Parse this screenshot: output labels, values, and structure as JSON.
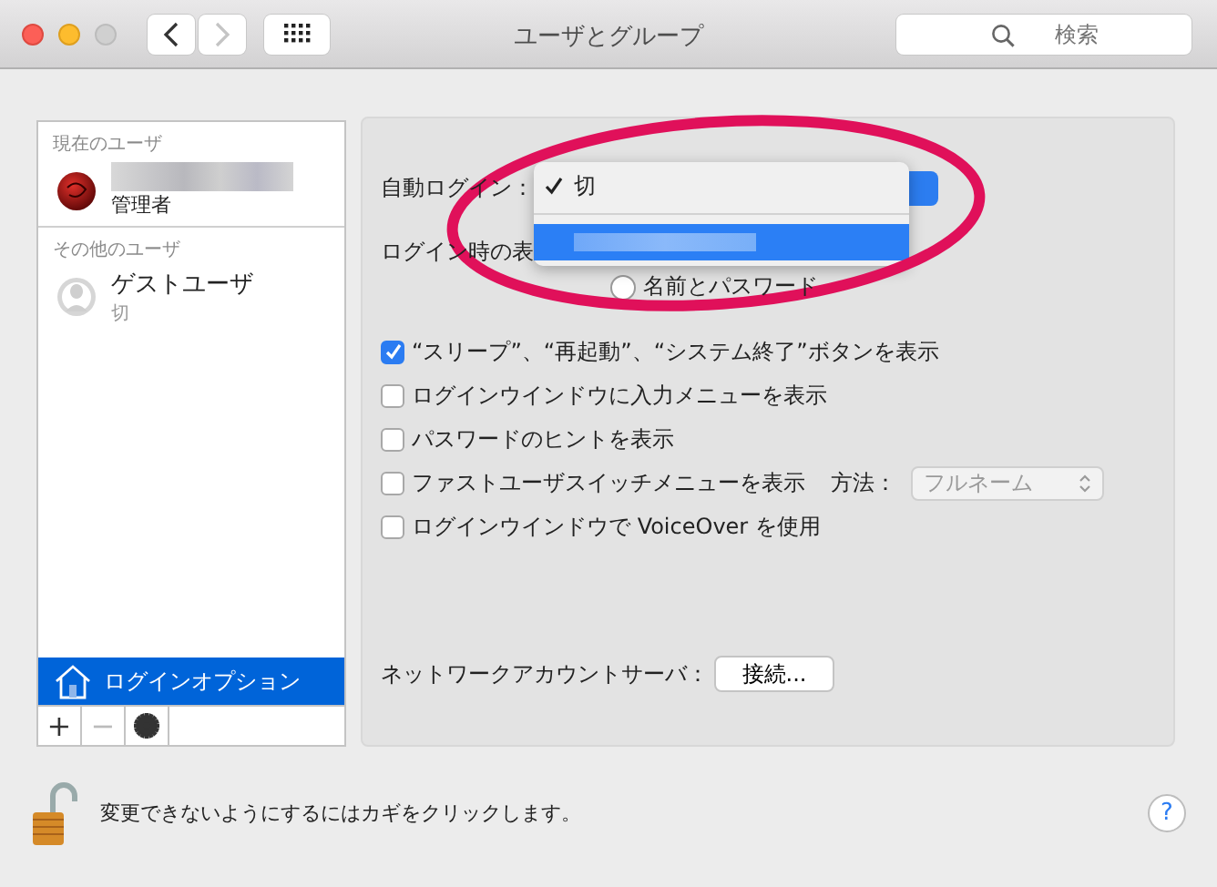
{
  "window": {
    "title": "ユーザとグループ",
    "search_placeholder": "検索",
    "nav": [
      {
        "kind": "back",
        "disabled": false
      },
      {
        "kind": "forward",
        "disabled": true
      },
      {
        "kind": "grid",
        "disabled": false
      }
    ]
  },
  "sidebar": {
    "current_heading": "現在のユーザ",
    "current_user": {
      "role": "管理者"
    },
    "other_heading": "その他のユーザ",
    "other_users": [
      {
        "name": "ゲストユーザ",
        "status": "切"
      }
    ],
    "login_options": {
      "label": "ログインオプション",
      "selected": true
    },
    "tools": [
      {
        "kind": "add",
        "label": "+",
        "disabled": false
      },
      {
        "kind": "remove",
        "label": "−",
        "disabled": true
      },
      {
        "kind": "settings",
        "disabled": false
      }
    ]
  },
  "panel": {
    "auto_login_label": "自動ログイン：",
    "menu": [
      {
        "kind": "text",
        "label": "切",
        "checked": true,
        "selected": false
      },
      {
        "kind": "blurred",
        "checked": false,
        "selected": true
      }
    ],
    "display_label": "ログイン時の表",
    "radio": {
      "label": "名前とパスワード",
      "selected": false
    },
    "checkboxes": [
      {
        "label": "“スリープ”、“再起動”、“システム終了”ボタンを表示",
        "checked": true
      },
      {
        "label": "ログインウインドウに入力メニューを表示",
        "checked": false
      },
      {
        "label": "パスワードのヒントを表示",
        "checked": false
      },
      {
        "label": "ファストユーザスイッチメニューを表示",
        "checked": false,
        "method": {
          "label": "方法：",
          "value": "フルネーム",
          "disabled": true
        }
      },
      {
        "label": "ログインウインドウで VoiceOver を使用",
        "checked": false
      }
    ],
    "network_label": "ネットワークアカウントサーバ：",
    "network_button": "接続..."
  },
  "footer": {
    "lock_text": "変更できないようにするにはカギをクリックします。",
    "help": "?"
  },
  "annotation": {
    "kind": "ellipse",
    "color": "#e0105a"
  }
}
